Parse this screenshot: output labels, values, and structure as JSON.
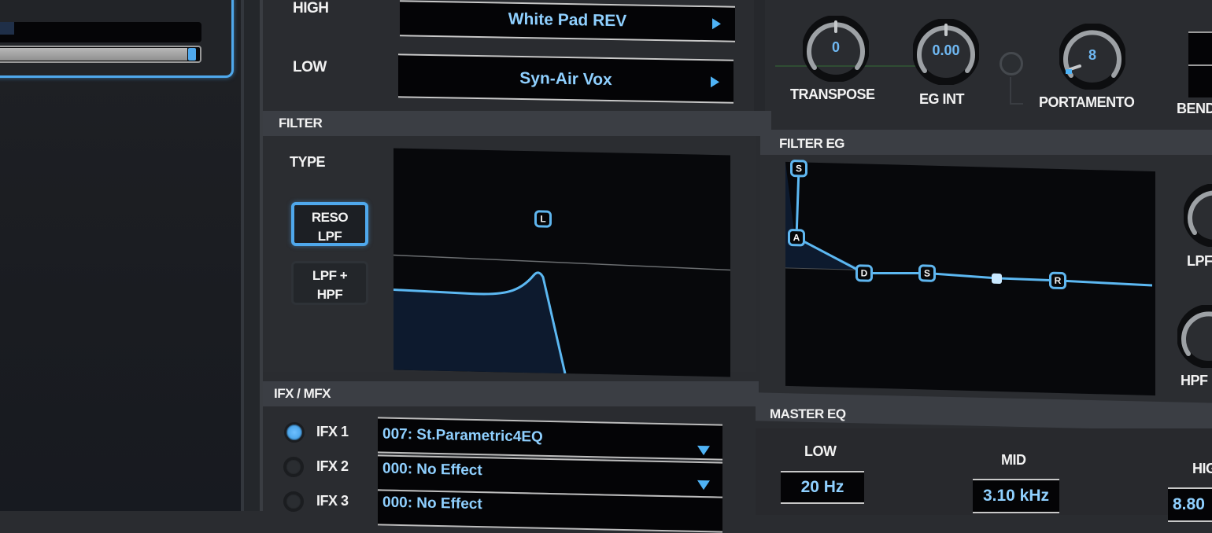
{
  "program_select": {
    "high_label": "HIGH",
    "high_value": "White Pad REV",
    "low_label": "LOW",
    "low_value": "Syn-Air Vox"
  },
  "controls": {
    "knobs": [
      {
        "label": "TRANSPOSE",
        "value": "0"
      },
      {
        "label": "EG INT",
        "value": "0.00"
      },
      {
        "label": "PORTAMENTO",
        "value": "8"
      }
    ],
    "bend_label": "BEND",
    "portamento_switch": "off"
  },
  "filter": {
    "header": "FILTER",
    "type_label": "TYPE",
    "types": [
      {
        "label_line1": "RESO",
        "label_line2": "LPF",
        "selected": true
      },
      {
        "label_line1": "LPF +",
        "label_line2": "HPF",
        "selected": false
      }
    ],
    "graph_marker": "L"
  },
  "filter_eg": {
    "header": "FILTER EG",
    "nodes": [
      "S",
      "A",
      "D",
      "S",
      "",
      "R"
    ],
    "side_knobs": [
      {
        "label": "LPF"
      },
      {
        "label": "HPF"
      }
    ]
  },
  "fx": {
    "header": "IFX / MFX",
    "slots": [
      {
        "label": "IFX 1",
        "value": "007: St.Parametric4EQ",
        "active": true
      },
      {
        "label": "IFX 2",
        "value": "000: No Effect",
        "active": false
      },
      {
        "label": "IFX 3",
        "value": "000: No Effect",
        "active": false
      }
    ]
  },
  "master_eq": {
    "header": "MASTER EQ",
    "bands": [
      {
        "label": "LOW",
        "value": "20 Hz"
      },
      {
        "label": "MID",
        "value": "3.10 kHz"
      },
      {
        "label": "HIGH",
        "value": "8.80"
      }
    ]
  },
  "colors": {
    "accent": "#4fa8ec",
    "value_text": "#8fd0ff",
    "panel": "#2a2c30",
    "header": "#3b3e44"
  }
}
